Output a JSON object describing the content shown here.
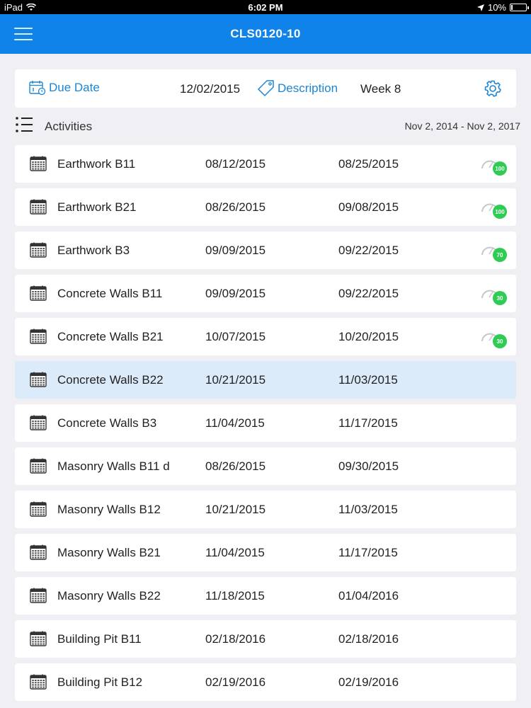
{
  "status_bar": {
    "device": "iPad",
    "time": "6:02 PM",
    "battery": "10%",
    "battery_level": 0.1
  },
  "nav": {
    "title": "CLS0120-10"
  },
  "filters": {
    "due_date_label": "Due Date",
    "due_date_value": "12/02/2015",
    "description_label": "Description",
    "description_value": "Week 8"
  },
  "activities": {
    "label": "Activities",
    "range": "Nov 2, 2014 - Nov 2, 2017",
    "rows": [
      {
        "name": "Earthwork B11",
        "start": "08/12/2015",
        "end": "08/25/2015",
        "progress": "100"
      },
      {
        "name": "Earthwork B21",
        "start": "08/26/2015",
        "end": "09/08/2015",
        "progress": "100"
      },
      {
        "name": "Earthwork B3",
        "start": "09/09/2015",
        "end": "09/22/2015",
        "progress": "70"
      },
      {
        "name": "Concrete Walls B11",
        "start": "09/09/2015",
        "end": "09/22/2015",
        "progress": "30"
      },
      {
        "name": "Concrete Walls B21",
        "start": "10/07/2015",
        "end": "10/20/2015",
        "progress": "30"
      },
      {
        "name": "Concrete Walls B22",
        "start": "10/21/2015",
        "end": "11/03/2015",
        "progress": null,
        "selected": true
      },
      {
        "name": "Concrete Walls B3",
        "start": "11/04/2015",
        "end": "11/17/2015",
        "progress": null
      },
      {
        "name": "Masonry Walls B11 d",
        "start": "08/26/2015",
        "end": "09/30/2015",
        "progress": null
      },
      {
        "name": "Masonry Walls B12",
        "start": "10/21/2015",
        "end": "11/03/2015",
        "progress": null
      },
      {
        "name": "Masonry Walls B21",
        "start": "11/04/2015",
        "end": "11/17/2015",
        "progress": null
      },
      {
        "name": "Masonry Walls B22",
        "start": "11/18/2015",
        "end": "01/04/2016",
        "progress": null
      },
      {
        "name": "Building Pit B11",
        "start": "02/18/2016",
        "end": "02/18/2016",
        "progress": null
      },
      {
        "name": "Building Pit B12",
        "start": "02/19/2016",
        "end": "02/19/2016",
        "progress": null
      }
    ]
  },
  "colors": {
    "accent": "#0f83e9",
    "link": "#1b86d6",
    "progress_badge": "#2ecc52",
    "selected_row": "#dcebfa"
  }
}
